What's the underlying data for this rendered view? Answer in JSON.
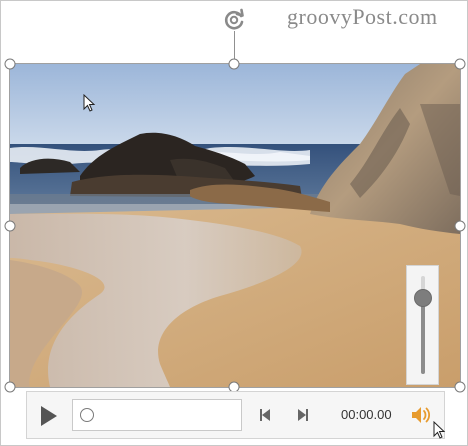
{
  "watermark": {
    "text": "groovyPost.com"
  },
  "media": {
    "scene": "beach-with-rocks-photo",
    "colors": {
      "sky_top": "#9cb6d9",
      "sky_bottom": "#c9d8ea",
      "sea": "#3f5f8a",
      "foam": "#e8eef5",
      "rock_dark": "#2f2a26",
      "cliff": "#a58e73",
      "sand": "#d7b489",
      "wet_sand": "#b8a79b"
    }
  },
  "volume": {
    "level": 0.78
  },
  "controls": {
    "play_icon": "play-icon",
    "timeline_progress": 0,
    "step_back_icon": "step-back-icon",
    "step_forward_icon": "step-forward-icon",
    "time": "00:00.00",
    "volume_icon": "speaker-icon",
    "accent": "#e79b2e"
  }
}
